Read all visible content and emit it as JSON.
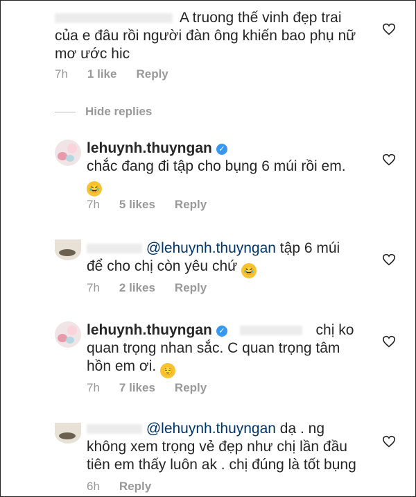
{
  "comments": [
    {
      "username_redacted": "",
      "lines": [
        "A truong thế vinh đẹp trai",
        "của e đâu rồi người đàn ông khiến bao phụ nữ",
        "mơ ước hic"
      ],
      "time": "7h",
      "likes": "1 like",
      "reply": "Reply"
    },
    {
      "username": "lehuynh.thuyngan",
      "lines": [
        "chắc đang đi tập cho bụng 6 múi rồi em."
      ],
      "time": "7h",
      "likes": "5 likes",
      "reply": "Reply"
    },
    {
      "mention": "@lehuynh.thuyngan",
      "line1_rest": " tập 6 múi",
      "line2": "để cho chị còn yêu chứ",
      "time": "7h",
      "likes": "2 likes",
      "reply": "Reply"
    },
    {
      "username": "lehuynh.thuyngan",
      "line1_rest": "chị ko",
      "lines": [
        "quan trọng nhan sắc. C quan trọng tâm",
        "hồn em ơi."
      ],
      "time": "7h",
      "likes": "7 likes",
      "reply": "Reply"
    },
    {
      "mention": "@lehuynh.thuyngan",
      "line1_rest": " dạ . ng",
      "lines": [
        "không xem trọng vẻ đẹp như chị lần đầu",
        "tiên em thấy luôn ak . chị đúng là tốt bụng"
      ],
      "time": "6h",
      "reply": "Reply"
    }
  ],
  "hide_replies": "Hide replies",
  "colors": {
    "text": "#262626",
    "meta": "#999999",
    "mention": "#003569",
    "verified": "#3897f0"
  }
}
